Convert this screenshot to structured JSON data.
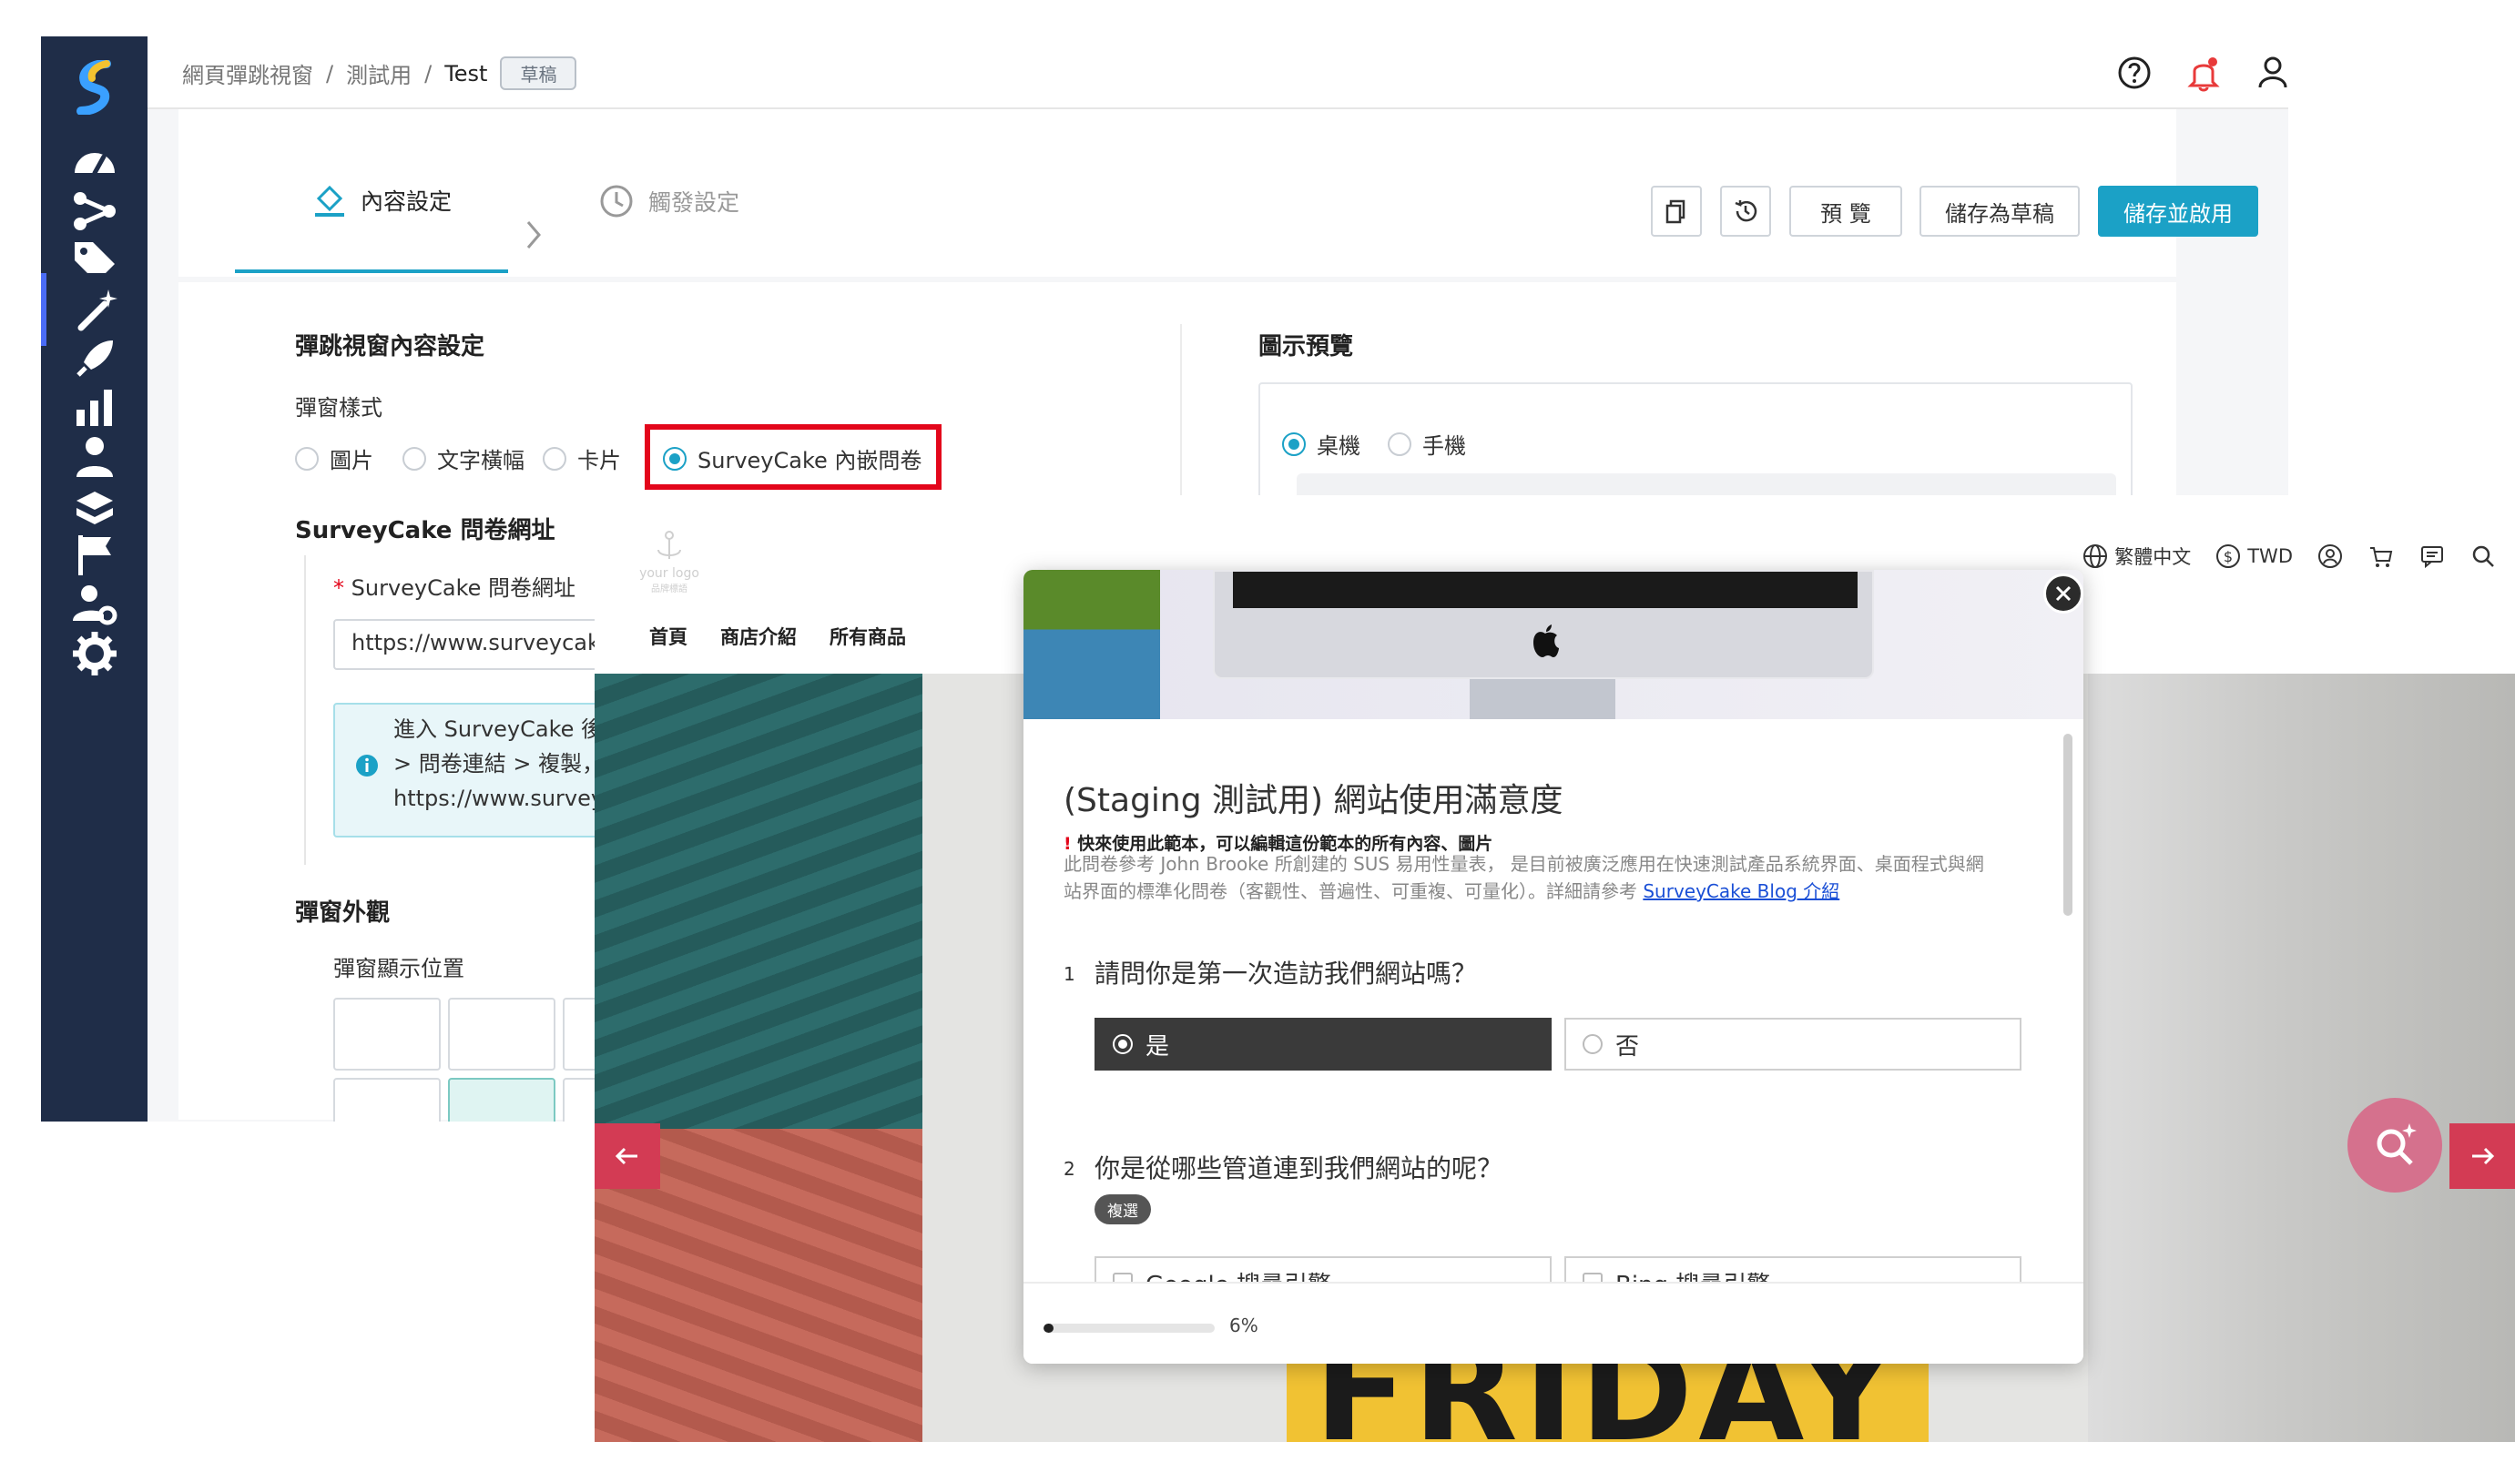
{
  "breadcrumb": {
    "items": [
      "網頁彈跳視窗",
      "測試用",
      "Test"
    ],
    "separator": "/",
    "status_badge": "草稿"
  },
  "header_icons": [
    "help-icon",
    "bell-icon",
    "user-icon"
  ],
  "steps": [
    {
      "label": "內容設定",
      "icon": "paint-bucket-icon",
      "active": true
    },
    {
      "label": "觸發設定",
      "icon": "clock-icon",
      "active": false
    }
  ],
  "toolbar": {
    "copy_icon": "copy-icon",
    "history_icon": "history-icon",
    "preview_label": "預 覽",
    "save_draft_label": "儲存為草稿",
    "save_enable_label": "儲存並啟用"
  },
  "content_settings": {
    "title": "彈跳視窗內容設定",
    "style_label": "彈窗樣式",
    "style_options": [
      "圖片",
      "文字橫幅",
      "卡片",
      "SurveyCake 內嵌問卷"
    ],
    "style_selected": "SurveyCake 內嵌問卷",
    "url_section_title": "SurveyCake 問卷網址",
    "url_field_label": "SurveyCake 問卷網址",
    "required_mark": "*",
    "url_value": "https://www.surveycake.co",
    "info_lines": [
      "進入 SurveyCake 後台的",
      "> 問卷連結 > 複製，然後",
      "https://www.surveycake"
    ],
    "appearance_title": "彈窗外觀",
    "position_label": "彈窗顯示位置"
  },
  "preview": {
    "title": "圖示預覽",
    "devices": [
      "桌機",
      "手機"
    ],
    "selected": "桌機"
  },
  "website": {
    "logo_text": "your logo",
    "logo_sub": "品牌標語",
    "nav": [
      "首頁",
      "商店介紹",
      "所有商品"
    ],
    "language": "繁體中文",
    "currency": "TWD",
    "header_icons": [
      "globe-icon",
      "dollar-icon",
      "account-icon",
      "cart-icon",
      "message-icon",
      "search-icon"
    ],
    "hero_text": "FRIDAY"
  },
  "survey": {
    "title": "(Staging 測試用) 網站使用滿意度",
    "warning_mark": "!",
    "warning": "快來使用此範本，可以編輯這份範本的所有內容、圖片",
    "desc_line1": "此問卷參考 John Brooke 所創建的 SUS 易用性量表， 是目前被廣泛應用在快速測試產品系統界面、桌面程式與網",
    "desc_line2": "站界面的標準化問卷（客觀性、普遍性、可重複、可量化）。詳細請參考 ",
    "desc_link": "SurveyCake Blog 介紹",
    "questions": [
      {
        "num": "1",
        "text": "請問你是第一次造訪我們網站嗎？",
        "options": [
          "是",
          "否"
        ],
        "selected": "是"
      },
      {
        "num": "2",
        "text": "你是從哪些管道連到我們網站的呢？",
        "badge": "複選",
        "options": [
          "Google 搜尋引擎",
          "Bing 搜尋引擎"
        ]
      }
    ],
    "progress_percent": 6,
    "progress_label": "6%"
  },
  "colors": {
    "sidebar": "#1f2d48",
    "accent": "#1ba1c6",
    "highlight": "#e3061b",
    "hero_arrow": "#d33b54",
    "search_fab": "#d5718d"
  }
}
